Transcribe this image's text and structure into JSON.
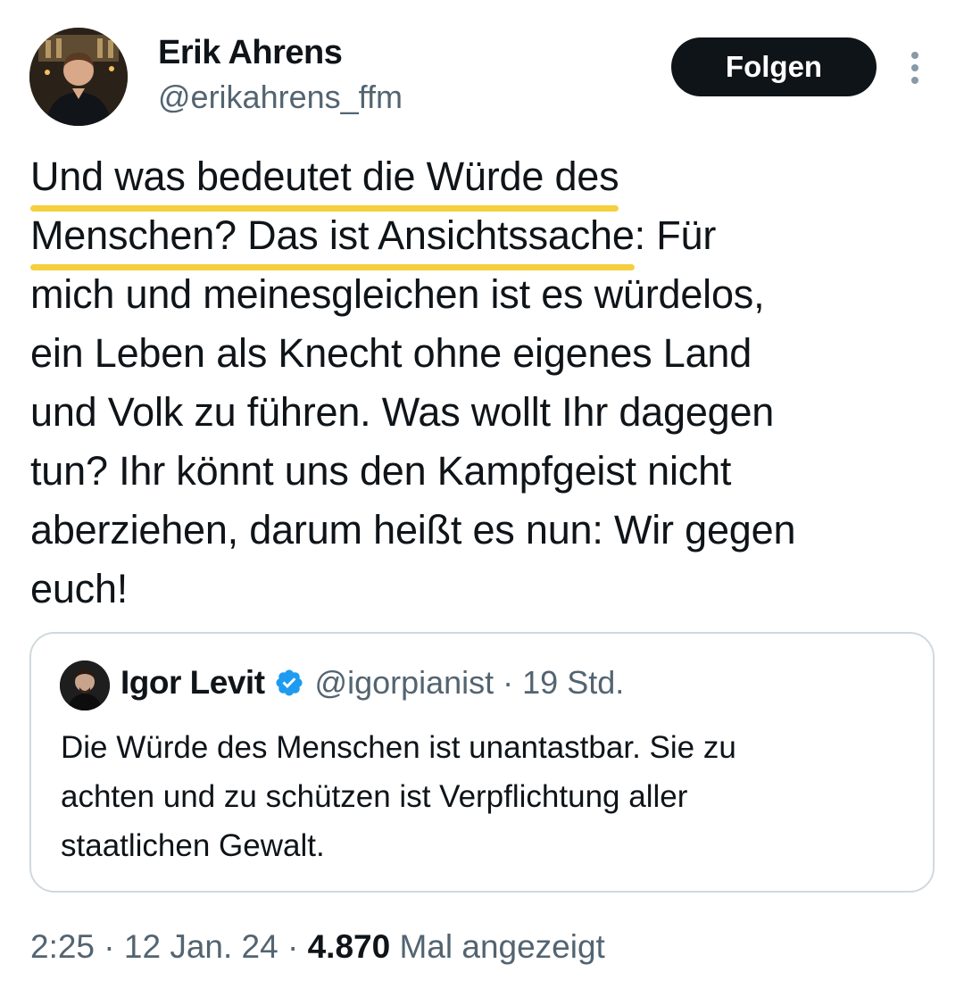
{
  "author": {
    "name": "Erik Ahrens",
    "handle": "@erikahrens_ffm"
  },
  "follow_label": "Folgen",
  "tweet": {
    "lines": [
      "Und was bedeutet die Würde des",
      "Menschen? Das ist Ansichtssache",
      ": Für",
      "mich und meinesgleichen ist es würdelos,",
      "ein Leben als Knecht ohne eigenes Land",
      "und Volk zu führen. Was wollt Ihr dagegen",
      "tun? Ihr könnt uns den Kampfgeist nicht",
      "aberziehen, darum heißt es nun: Wir gegen",
      "euch!"
    ],
    "highlight_color": "#f6cf3d"
  },
  "quoted_tweet": {
    "name": "Igor Levit",
    "handle": "@igorpianist · 19 Std.",
    "lines": [
      "Die Würde des Menschen ist unantastbar. Sie zu",
      "achten und zu schützen ist Verpflichtung aller",
      "staatlichen Gewalt."
    ]
  },
  "meta": {
    "time_date": "2:25 · 12 Jan. 24 · ",
    "views_count": "4.870",
    "views_label": " Mal angezeigt"
  },
  "icons": {
    "more": "more-vertical-icon",
    "verified": "verified-badge-icon"
  },
  "colors": {
    "text": "#0f1419",
    "secondary": "#536471",
    "verified": "#1d9bf0",
    "button": "#0f1419",
    "border": "#cfd9de"
  }
}
